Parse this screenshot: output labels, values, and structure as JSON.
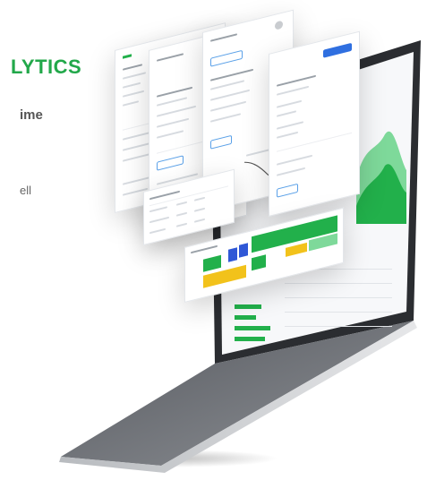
{
  "copy": {
    "heading": "LYTICS",
    "subheading": "ime",
    "fragment": "ell"
  },
  "colors": {
    "accent_green": "#22a84a",
    "chart_green": "#22b04b",
    "chart_light_green": "#7ed99a",
    "chart_blue": "#2f57d6",
    "chart_yellow": "#f2c21b",
    "laptop_body": "#2b2d31"
  }
}
